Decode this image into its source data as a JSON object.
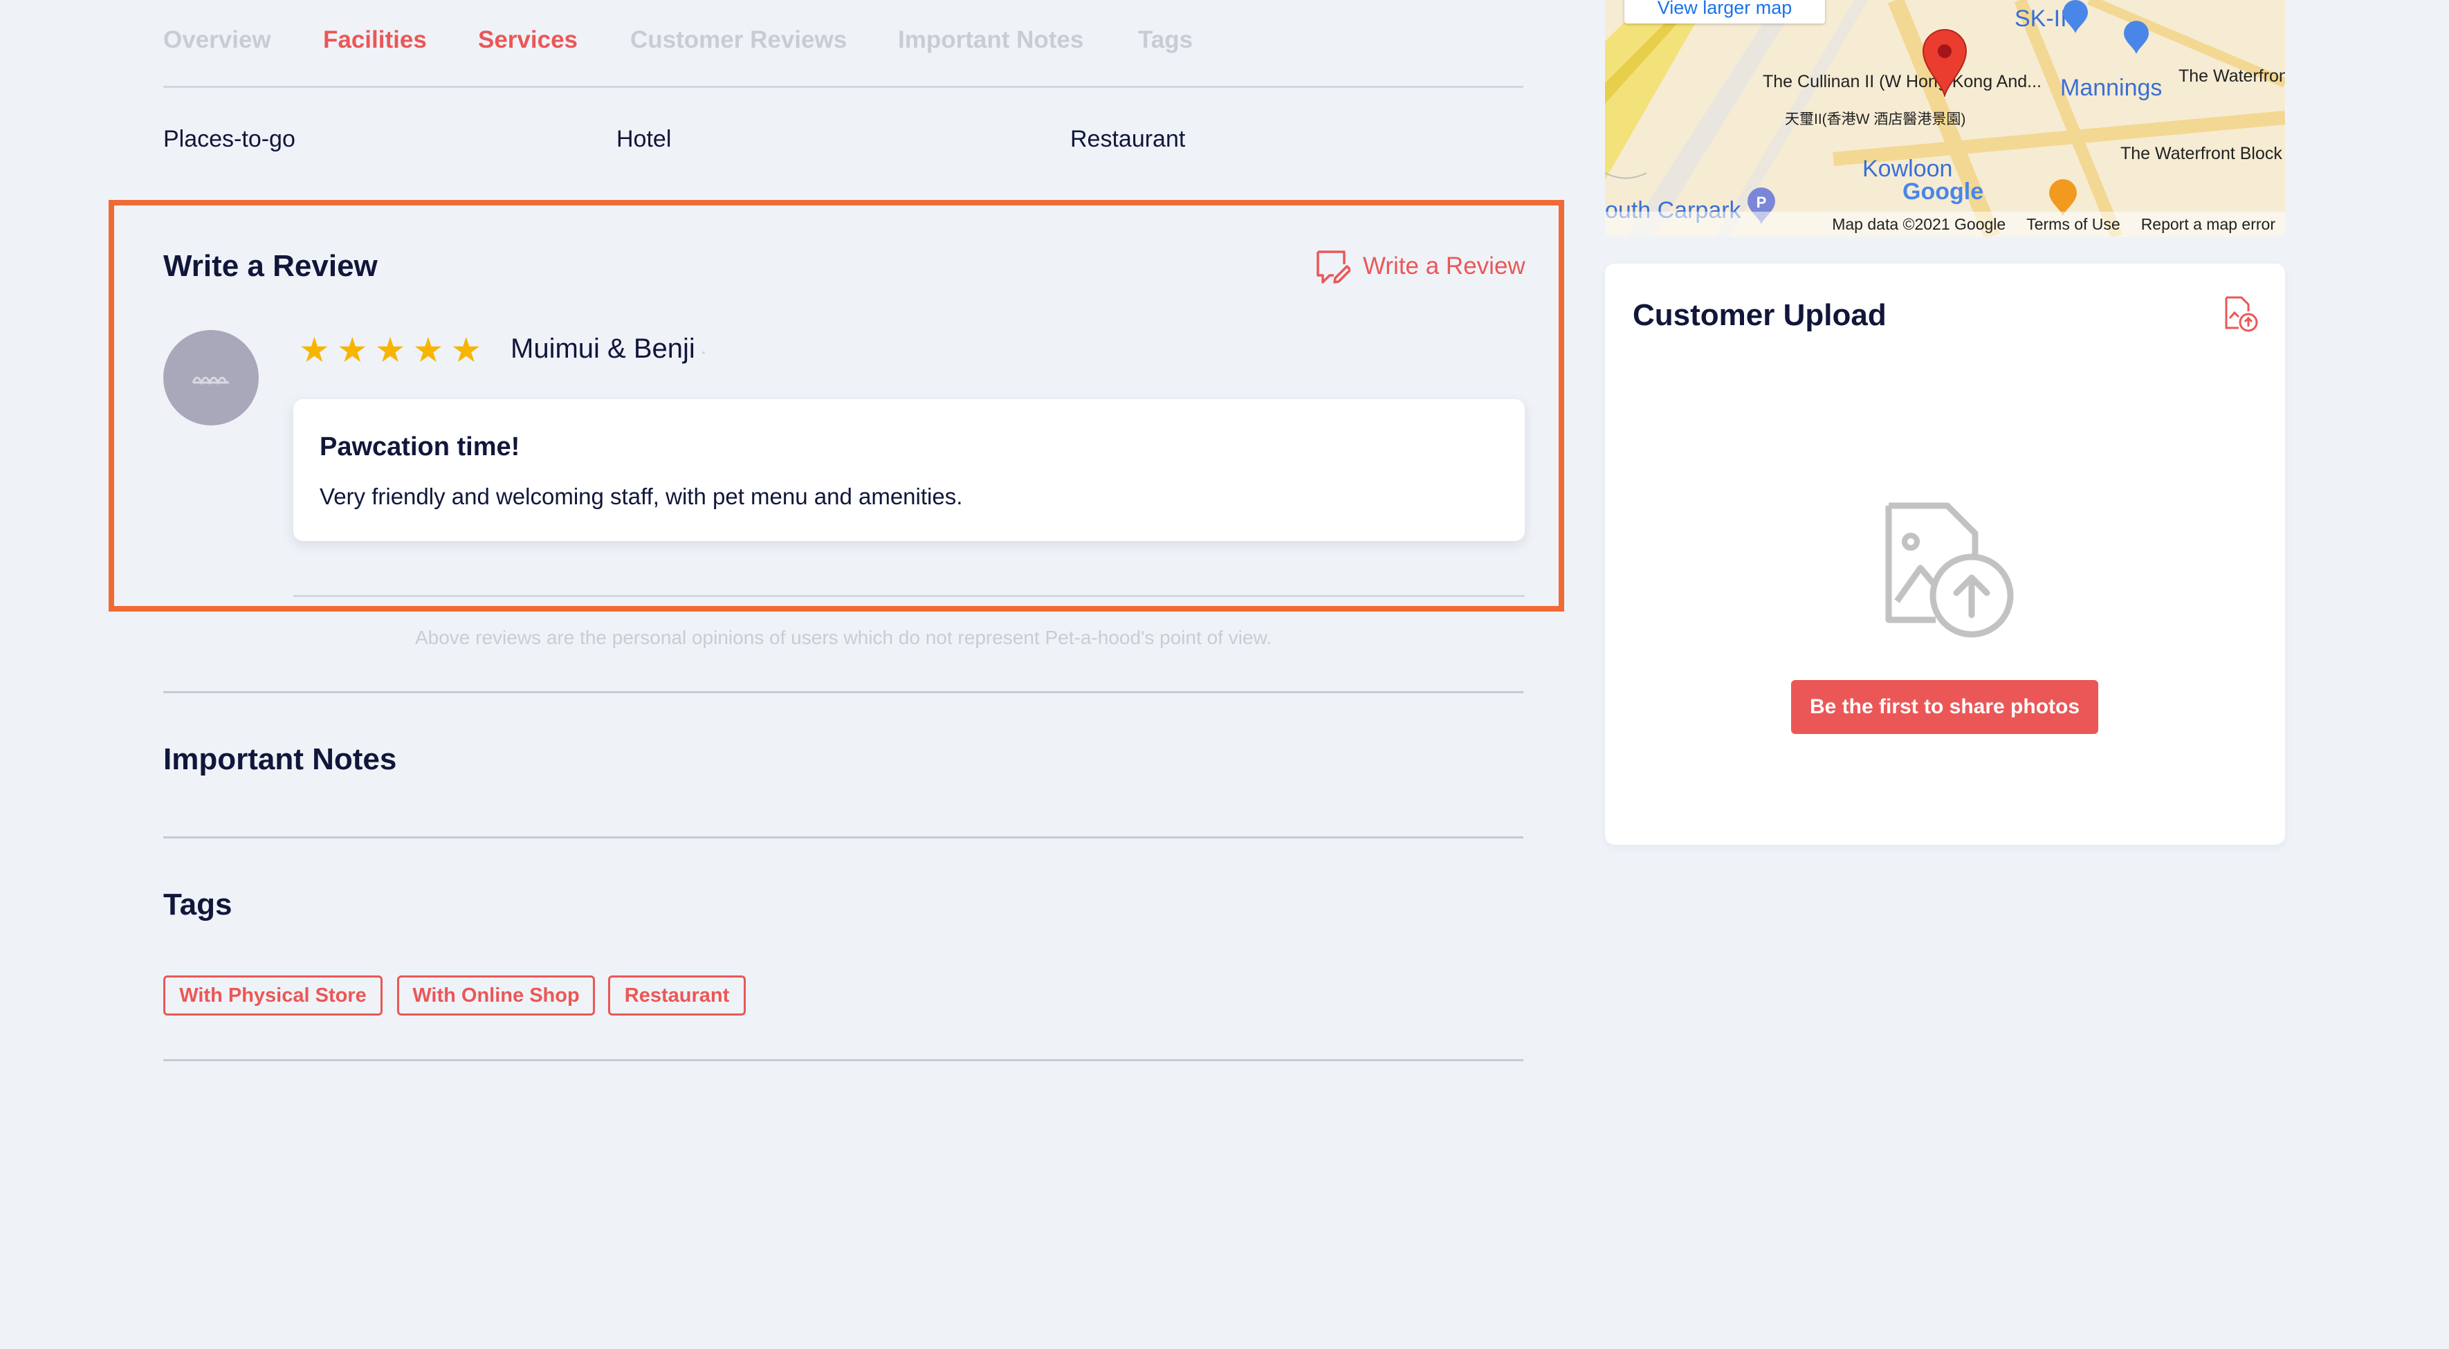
{
  "tabs": [
    "Overview",
    "Facilities",
    "Services",
    "Customer Reviews",
    "Important Notes",
    "Tags"
  ],
  "categories": [
    "Places-to-go",
    "Hotel",
    "Restaurant"
  ],
  "review_section": {
    "title": "Write a Review",
    "write_link": "Write a Review",
    "rating": 5,
    "reviewer": "Muimui & Benji",
    "reviewer_suffix": "·",
    "review_title": "Pawcation time!",
    "review_body": "Very friendly and welcoming staff, with pet menu and amenities."
  },
  "disclaimer": "Above reviews are the personal opinions of users which do not represent Pet-a-hood's point of view.",
  "important_notes": {
    "title": "Important Notes"
  },
  "tags_section": {
    "title": "Tags",
    "tags": [
      "With Physical Store",
      "With Online Shop",
      "Restaurant"
    ]
  },
  "map": {
    "view_larger": "View larger map",
    "labels": {
      "cullinan": "The Cullinan II (W Hong Kong And...",
      "cullinan_cn": "天璽II(香港W 酒店醫港景園)",
      "mannings": "Mannings",
      "skii": "SK-II",
      "kowloon": "Kowloon",
      "waterfront": "The Waterfron",
      "waterfront_block": "The Waterfront Block",
      "carpark": "outh Carpark",
      "google": "Google"
    },
    "footer": {
      "data": "Map data ©2021 Google",
      "terms": "Terms of Use",
      "report": "Report a map error"
    }
  },
  "upload": {
    "title": "Customer Upload",
    "button": "Be the first to share photos"
  },
  "colors": {
    "accent": "#eb5757",
    "highlight": "#f06a35",
    "star": "#f7b500",
    "background": "#eff3f8"
  }
}
